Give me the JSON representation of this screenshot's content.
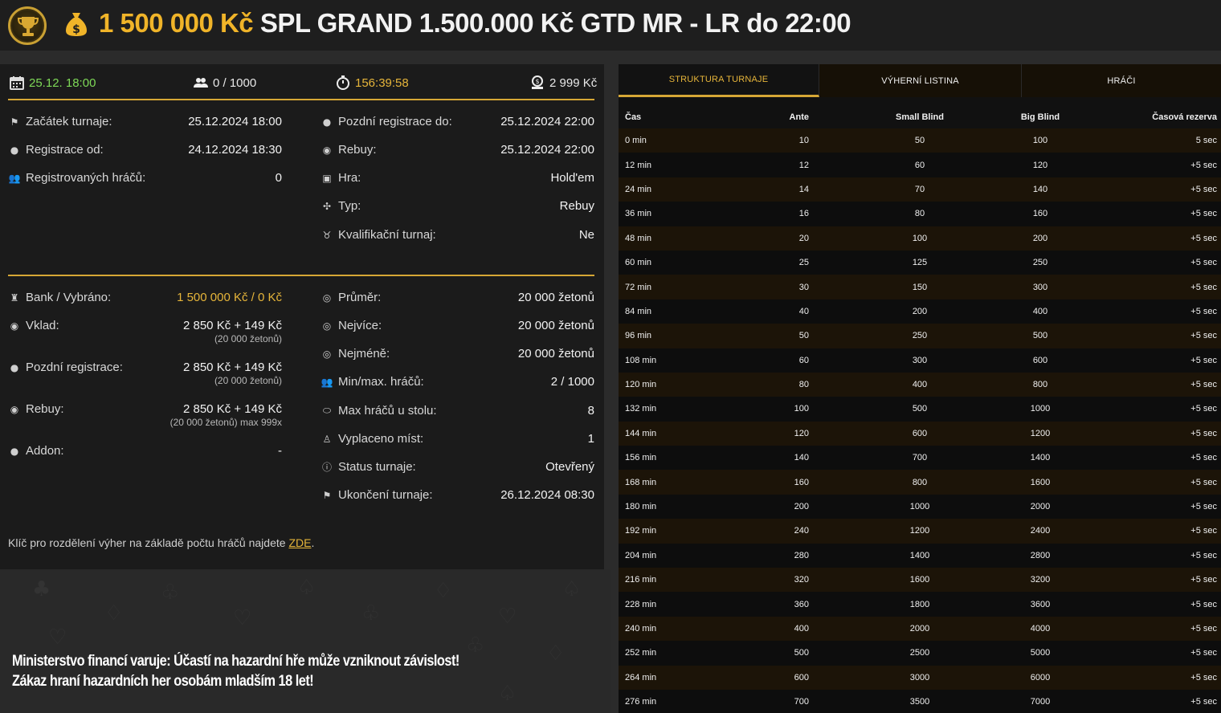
{
  "header": {
    "amount": "1 500 000 Kč",
    "title": "SPL GRAND 1.500.000 Kč GTD MR - LR do 22:00"
  },
  "topstats": {
    "date": "25.12. 18:00",
    "players": "0 / 1000",
    "timer": "156:39:58",
    "buyin": "2 999 Kč"
  },
  "info_left": [
    {
      "label": "Začátek turnaje:",
      "value": "25.12.2024 18:00"
    },
    {
      "label": "Registrace od:",
      "value": "24.12.2024 18:30"
    },
    {
      "label": "Registrovaných hráčů:",
      "value": "0"
    }
  ],
  "info_right": [
    {
      "label": "Pozdní registrace do:",
      "value": "25.12.2024 22:00"
    },
    {
      "label": "Rebuy:",
      "value": "25.12.2024 22:00"
    },
    {
      "label": "Hra:",
      "value": "Hold'em"
    },
    {
      "label": "Typ:",
      "value": "Rebuy"
    },
    {
      "label": "Kvalifikační turnaj:",
      "value": "Ne"
    }
  ],
  "money_left": [
    {
      "label": "Bank / Vybráno:",
      "value": "1 500 000 Kč / 0 Kč",
      "sub": ""
    },
    {
      "label": "Vklad:",
      "value": "2 850 Kč + 149 Kč",
      "sub": "(20 000 žetonů)"
    },
    {
      "label": "Pozdní registrace:",
      "value": "2 850 Kč + 149 Kč",
      "sub": "(20 000 žetonů)"
    },
    {
      "label": "Rebuy:",
      "value": "2 850 Kč + 149 Kč",
      "sub": "(20 000 žetonů) max 999x"
    },
    {
      "label": "Addon:",
      "value": "-",
      "sub": ""
    }
  ],
  "money_right": [
    {
      "label": "Průměr:",
      "value": "20 000 žetonů"
    },
    {
      "label": "Nejvíce:",
      "value": "20 000 žetonů"
    },
    {
      "label": "Nejméně:",
      "value": "20 000 žetonů"
    },
    {
      "label": "Min/max. hráčů:",
      "value": "2 / 1000"
    },
    {
      "label": "Max hráčů u stolu:",
      "value": "8"
    },
    {
      "label": "Vyplaceno míst:",
      "value": "1"
    },
    {
      "label": "Status turnaje:",
      "value": "Otevřený"
    },
    {
      "label": "Ukončení turnaje:",
      "value": "26.12.2024 08:30"
    }
  ],
  "footnote": {
    "text": "Klíč pro rozdělení výher na základě počtu hráčů najdete ",
    "link": "ZDE",
    "end": "."
  },
  "warning": {
    "line1": "Ministerstvo financí varuje: Účastí na hazardní hře může vzniknout závislost!",
    "line2": "Zákaz hraní hazardních her osobám mladším 18 let!"
  },
  "tabs": [
    "STRUKTURA TURNAJE",
    "VÝHERNÍ LISTINA",
    "HRÁČI"
  ],
  "table": {
    "headers": [
      "Čas",
      "Ante",
      "Small Blind",
      "Big Blind",
      "Časová rezerva"
    ],
    "rows": [
      [
        "0 min",
        "10",
        "50",
        "100",
        "5 sec"
      ],
      [
        "12 min",
        "12",
        "60",
        "120",
        "+5 sec"
      ],
      [
        "24 min",
        "14",
        "70",
        "140",
        "+5 sec"
      ],
      [
        "36 min",
        "16",
        "80",
        "160",
        "+5 sec"
      ],
      [
        "48 min",
        "20",
        "100",
        "200",
        "+5 sec"
      ],
      [
        "60 min",
        "25",
        "125",
        "250",
        "+5 sec"
      ],
      [
        "72 min",
        "30",
        "150",
        "300",
        "+5 sec"
      ],
      [
        "84 min",
        "40",
        "200",
        "400",
        "+5 sec"
      ],
      [
        "96 min",
        "50",
        "250",
        "500",
        "+5 sec"
      ],
      [
        "108 min",
        "60",
        "300",
        "600",
        "+5 sec"
      ],
      [
        "120 min",
        "80",
        "400",
        "800",
        "+5 sec"
      ],
      [
        "132 min",
        "100",
        "500",
        "1000",
        "+5 sec"
      ],
      [
        "144 min",
        "120",
        "600",
        "1200",
        "+5 sec"
      ],
      [
        "156 min",
        "140",
        "700",
        "1400",
        "+5 sec"
      ],
      [
        "168 min",
        "160",
        "800",
        "1600",
        "+5 sec"
      ],
      [
        "180 min",
        "200",
        "1000",
        "2000",
        "+5 sec"
      ],
      [
        "192 min",
        "240",
        "1200",
        "2400",
        "+5 sec"
      ],
      [
        "204 min",
        "280",
        "1400",
        "2800",
        "+5 sec"
      ],
      [
        "216 min",
        "320",
        "1600",
        "3200",
        "+5 sec"
      ],
      [
        "228 min",
        "360",
        "1800",
        "3600",
        "+5 sec"
      ],
      [
        "240 min",
        "400",
        "2000",
        "4000",
        "+5 sec"
      ],
      [
        "252 min",
        "500",
        "2500",
        "5000",
        "+5 sec"
      ],
      [
        "264 min",
        "600",
        "3000",
        "6000",
        "+5 sec"
      ],
      [
        "276 min",
        "700",
        "3500",
        "7000",
        "+5 sec"
      ]
    ]
  }
}
